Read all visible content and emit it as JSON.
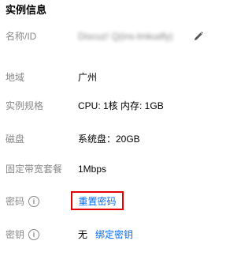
{
  "section": {
    "title": "实例信息"
  },
  "rows": {
    "name": {
      "label": "名称/ID",
      "value": "Discuz! Q(ins-lmkudfy)",
      "edit_icon": "edit-pencil-icon"
    },
    "region": {
      "label": "地域",
      "value": "广州"
    },
    "spec": {
      "label": "实例规格",
      "value": "CPU: 1核 内存: 1GB"
    },
    "disk": {
      "label": "磁盘",
      "value": "系统盘：20GB"
    },
    "bandwidth": {
      "label": "固定带宽套餐",
      "value": "1Mbps"
    },
    "password": {
      "label": "密码",
      "info_icon": "info-icon",
      "action": "重置密码"
    },
    "key": {
      "label": "密钥",
      "info_icon": "info-icon",
      "value": "无",
      "action": "绑定密钥"
    }
  },
  "colors": {
    "label": "#888888",
    "link": "#006eff",
    "highlight_border": "#e30000"
  }
}
